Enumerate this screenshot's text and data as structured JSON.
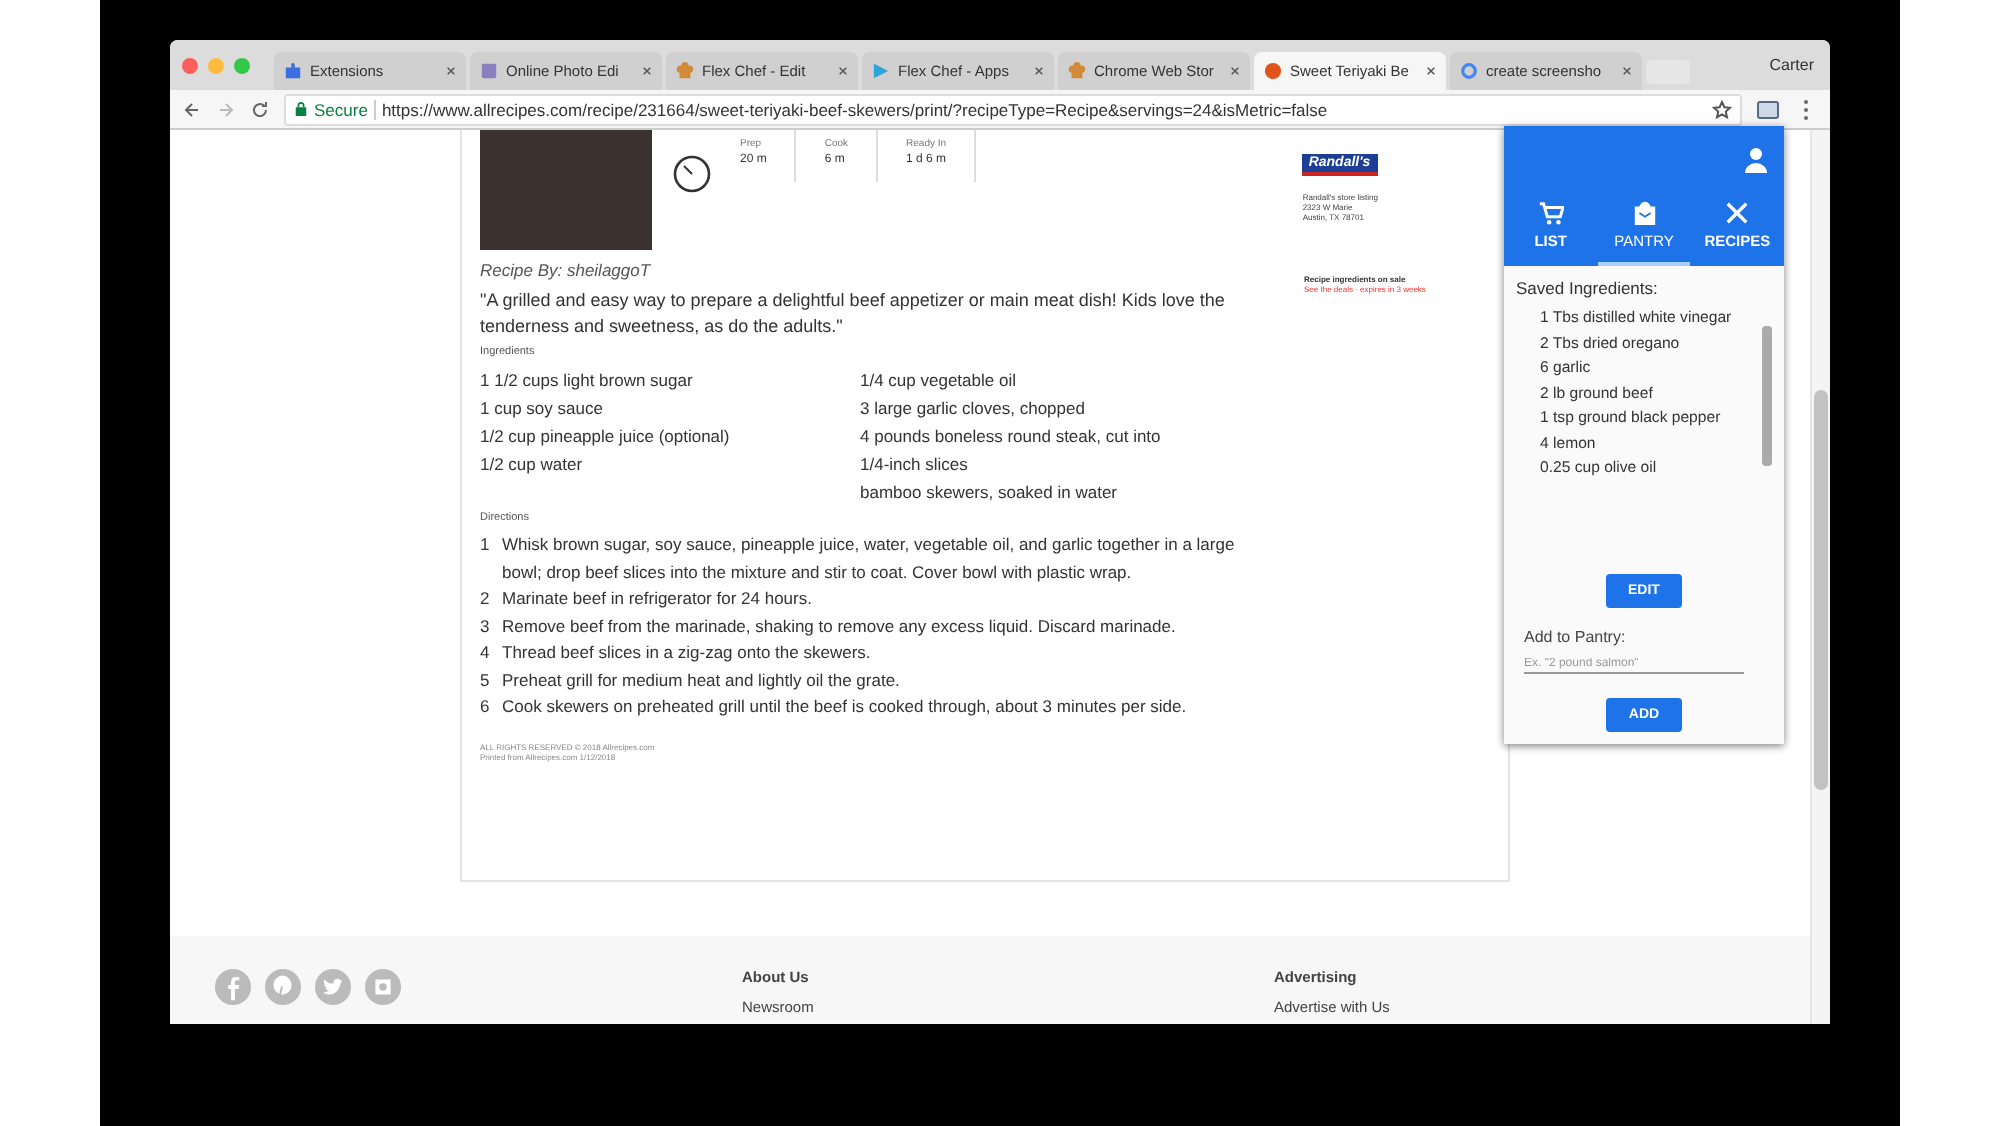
{
  "tabs": [
    {
      "label": "Extensions",
      "kind": "puzzle",
      "selected": false
    },
    {
      "label": "Online Photo Edi",
      "kind": "photo",
      "selected": false
    },
    {
      "label": "Flex Chef - Edit",
      "kind": "chef",
      "selected": false
    },
    {
      "label": "Flex Chef - Apps",
      "kind": "store",
      "selected": false
    },
    {
      "label": "Chrome Web Stor",
      "kind": "chef",
      "selected": false
    },
    {
      "label": "Sweet Teriyaki Be",
      "kind": "recipe",
      "selected": true
    },
    {
      "label": "create screensho",
      "kind": "search",
      "selected": false
    }
  ],
  "profile": "Carter",
  "address_bar": {
    "secure_label": "Secure",
    "url": "https://www.allrecipes.com/recipe/231664/sweet-teriyaki-beef-skewers/print/?recipeType=Recipe&servings=24&isMetric=false"
  },
  "recipe": {
    "times": [
      {
        "label": "Prep",
        "value": "20 m"
      },
      {
        "label": "Cook",
        "value": "6 m"
      },
      {
        "label": "Ready In",
        "value": "1 d 6 m"
      }
    ],
    "store": {
      "logo": "Randall's",
      "lines": [
        "Randall's store listing",
        "2323 W Marie",
        "Austin, TX 78701"
      ]
    },
    "sale": {
      "title": "Recipe ingredients on sale",
      "link": "See the deals · expires in 3 weeks"
    },
    "author": "Recipe By: sheilaggoT",
    "description": "\"A grilled and easy way to prepare a delightful beef appetizer or main meat dish! Kids love the tenderness and sweetness, as do the adults.\"",
    "ingredients_heading": "Ingredients",
    "ingredients": [
      [
        "1 1/2 cups light brown sugar",
        "1 cup soy sauce",
        "1/2 cup pineapple juice (optional)",
        "1/2 cup water"
      ],
      [
        "1/4 cup vegetable oil",
        "3 large garlic cloves, chopped",
        "4 pounds boneless round steak, cut into",
        "1/4-inch slices",
        "bamboo skewers, soaked in water"
      ]
    ],
    "directions_heading": "Directions",
    "directions": [
      {
        "number": "1",
        "text": "Whisk brown sugar, soy sauce, pineapple juice, water, vegetable oil, and garlic together in a large bowl; drop beef slices into the mixture and stir to coat. Cover bowl with plastic wrap."
      },
      {
        "number": "2",
        "text": "Marinate beef in refrigerator for 24 hours."
      },
      {
        "number": "3",
        "text": "Remove beef from the marinade, shaking to remove any excess liquid. Discard marinade."
      },
      {
        "number": "4",
        "text": "Thread beef slices in a zig-zag onto the skewers."
      },
      {
        "number": "5",
        "text": "Preheat grill for medium heat and lightly oil the grate."
      },
      {
        "number": "6",
        "text": "Cook skewers on preheated grill until the beef is cooked through, about 3 minutes per side."
      }
    ],
    "footer_lines": [
      "ALL RIGHTS RESERVED © 2018 Allrecipes.com",
      "Printed from Allrecipes.com 1/12/2018"
    ]
  },
  "site_footer": {
    "social": [
      {
        "kind": "facebook"
      },
      {
        "kind": "pinterest"
      },
      {
        "kind": "twitter"
      },
      {
        "kind": "instagram"
      }
    ],
    "columns": [
      {
        "heading": "About Us",
        "link": "Newsroom"
      },
      {
        "heading": "Advertising",
        "link": "Advertise with Us"
      }
    ]
  },
  "extension": {
    "nav": [
      {
        "label": "LIST",
        "kind": "cart",
        "selected": false
      },
      {
        "label": "PANTRY",
        "kind": "bag",
        "selected": true
      },
      {
        "label": "RECIPES",
        "kind": "utensils",
        "selected": false
      }
    ],
    "saved_heading": "Saved Ingredients:",
    "saved": [
      "1 Tbs distilled white vinegar",
      "2 Tbs dried oregano",
      "6 garlic",
      "2 lb ground beef",
      "1 tsp ground black pepper",
      "4 lemon",
      "0.25 cup olive oil"
    ],
    "edit_button": "EDIT",
    "add_label": "Add to Pantry:",
    "add_placeholder": "Ex. \"2 pound salmon\"",
    "add_button": "ADD"
  }
}
